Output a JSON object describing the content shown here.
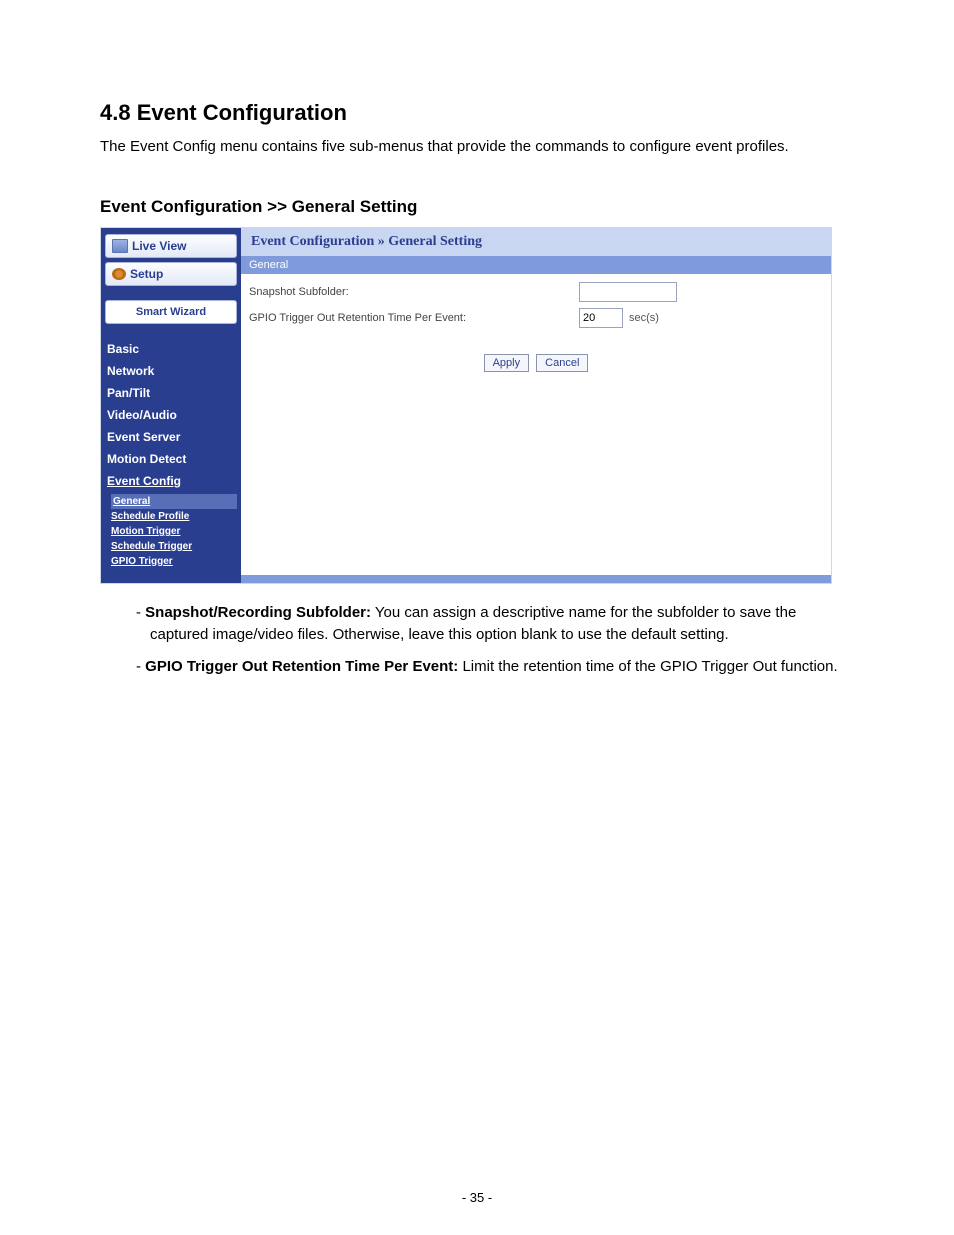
{
  "doc": {
    "heading": "4.8  Event Configuration",
    "intro": "The Event Config menu contains five sub-menus that provide the commands to configure event profiles.",
    "subheading": "Event Configuration >> General Setting",
    "page_number": "- 35 -"
  },
  "sidebar": {
    "live_view": "Live View",
    "setup": "Setup",
    "smart_wizard": "Smart Wizard",
    "items": [
      "Basic",
      "Network",
      "Pan/Tilt",
      "Video/Audio",
      "Event Server",
      "Motion Detect",
      "Event Config"
    ],
    "subitems": [
      "General",
      "Schedule Profile",
      "Motion Trigger",
      "Schedule Trigger",
      "GPIO Trigger"
    ]
  },
  "panel": {
    "breadcrumb": "Event Configuration » General Setting",
    "section": "General",
    "snapshot_label": "Snapshot Subfolder:",
    "snapshot_value": "",
    "gpio_label": "GPIO Trigger Out Retention Time Per Event:",
    "gpio_value": "20",
    "gpio_unit": "sec(s)",
    "apply": "Apply",
    "cancel": "Cancel"
  },
  "bullets": {
    "b1_label": "Snapshot/Recording Subfolder:",
    "b1_text": " You can assign a descriptive name for the subfolder to save the captured image/video files. Otherwise, leave this option blank to use the default setting.",
    "b2_label": "GPIO Trigger Out Retention Time Per Event:",
    "b2_text": " Limit the retention time of the GPIO Trigger Out function."
  }
}
